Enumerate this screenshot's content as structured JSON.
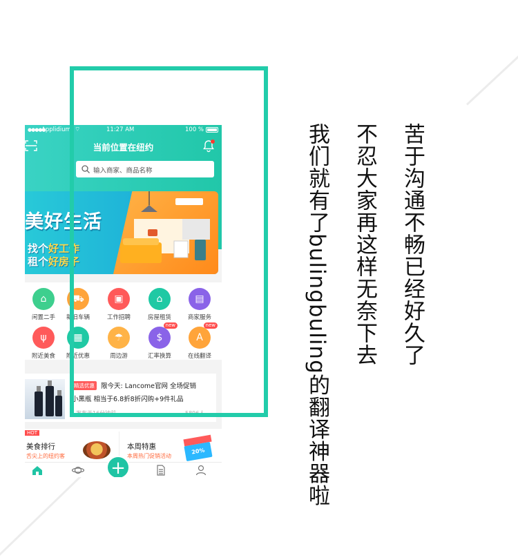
{
  "status_bar": {
    "carrier": "Applidium",
    "time": "11:27 AM",
    "battery": "100 %"
  },
  "nav": {
    "title": "当前位置在纽约"
  },
  "search": {
    "placeholder": "输入商家、商品名称"
  },
  "banner": {
    "title": "美好生活",
    "line1_a": "找个",
    "line1_b": "好工作",
    "line2_a": "租个",
    "line2_b": "好房子"
  },
  "categories": [
    {
      "label": "闲置二手",
      "icon": "basket-icon",
      "color": "#3ecf8e"
    },
    {
      "label": "新旧车辆",
      "icon": "car-icon",
      "color": "#ffa43a"
    },
    {
      "label": "工作招聘",
      "icon": "id-card-icon",
      "color": "#ff5a5a"
    },
    {
      "label": "房屋租赁",
      "icon": "house-icon",
      "color": "#1fc9a4"
    },
    {
      "label": "商家服务",
      "icon": "shop-icon",
      "color": "#8a63e8"
    },
    {
      "label": "附近美食",
      "icon": "fork-knife-icon",
      "color": "#ff5a5a"
    },
    {
      "label": "附近优惠",
      "icon": "coupon-icon",
      "color": "#1fc9a4"
    },
    {
      "label": "周边游",
      "icon": "beach-icon",
      "color": "#ffb347"
    },
    {
      "label": "汇率换算",
      "icon": "currency-icon",
      "color": "#8a63e8",
      "badge": "new"
    },
    {
      "label": "在线翻译",
      "icon": "translate-icon",
      "color": "#ffa43a",
      "badge": "new"
    }
  ],
  "promo": {
    "tag": "精选优惠",
    "title": "限今天: Lancome官网 全场促销",
    "desc": "小黑瓶 相当于6.8折8折闪购+9件礼品",
    "time": "发布于16分钟前",
    "count": "5896人"
  },
  "cards": {
    "left": {
      "badge": "HOT",
      "title": "美食排行",
      "sub": "舌尖上的纽约客"
    },
    "right": {
      "title": "本周特惠",
      "sub": "本周热门促销活动",
      "coupon": "20%"
    }
  },
  "tabbar": {
    "items": [
      "home-icon",
      "planet-icon",
      "plus-icon",
      "document-icon",
      "profile-icon"
    ],
    "plus": "+"
  },
  "headline": {
    "line1": "苦于沟通不畅已经好久了",
    "line2": "不忍大家再这样无奈下去",
    "line3": "我们就有了bulingbuling的翻译神器啦"
  },
  "colors": {
    "accent": "#22ccaa",
    "header_gradient_start": "#3ad3c4",
    "header_gradient_end": "#21c7a9",
    "banner_orange": "#ff8a1a",
    "hot_red": "#ff4d4d"
  }
}
